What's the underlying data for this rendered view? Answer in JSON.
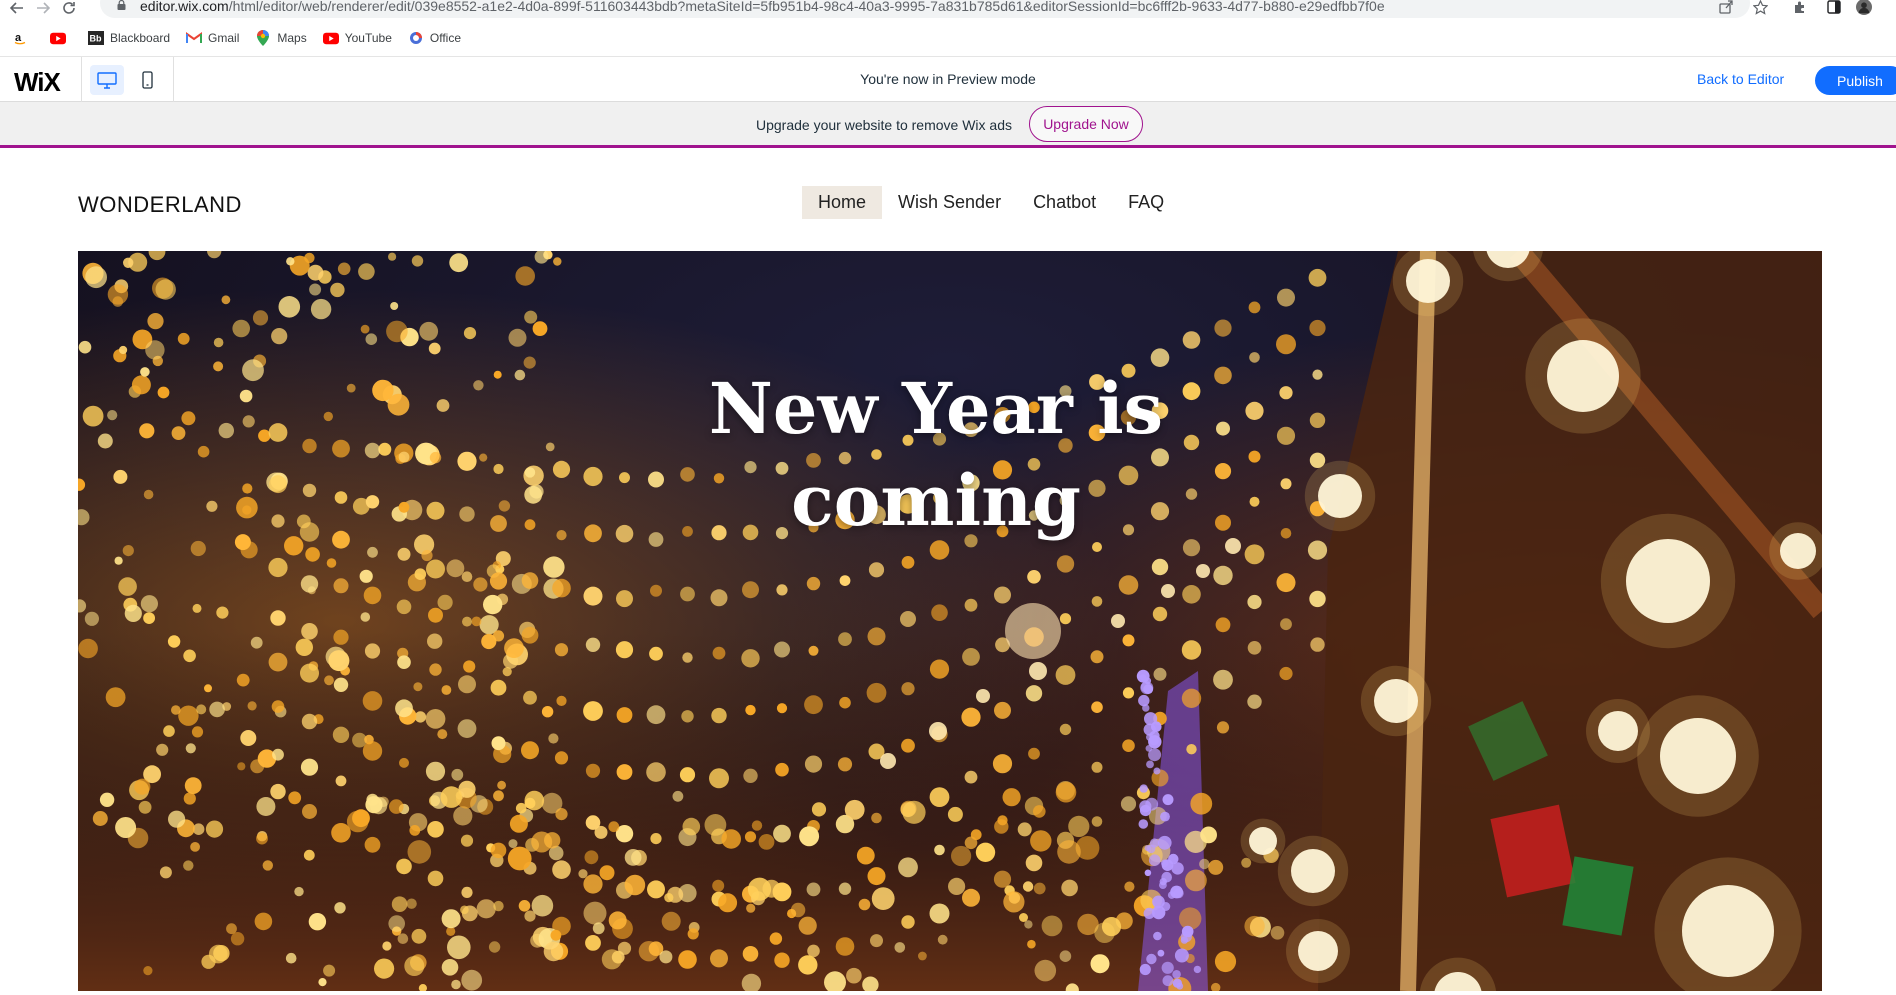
{
  "browser": {
    "url_host": "editor.wix.com",
    "url_path": "/html/editor/web/renderer/edit/039e8552-a1e2-4d0a-899f-511603443bdb?metaSiteId=5fb951b4-98c4-40a3-9995-7a831b785d61&editorSessionId=bc6fff2b-9633-4d77-b880-e29edfbb7f0e",
    "bookmarks": [
      {
        "label": "",
        "icon": "amazon-icon"
      },
      {
        "label": "",
        "icon": "youtube-icon"
      },
      {
        "label": "Blackboard",
        "icon": "blackboard-icon"
      },
      {
        "label": "Gmail",
        "icon": "gmail-icon"
      },
      {
        "label": "Maps",
        "icon": "maps-icon"
      },
      {
        "label": "YouTube",
        "icon": "youtube-icon"
      },
      {
        "label": "Office",
        "icon": "office-icon"
      }
    ]
  },
  "wix_bar": {
    "logo": "WiX",
    "preview_message": "You're now in Preview mode",
    "back_to_editor": "Back to Editor",
    "publish": "Publish"
  },
  "upgrade_banner": {
    "message": "Upgrade your website to remove Wix ads",
    "button": "Upgrade Now"
  },
  "site": {
    "logo": "WONDERLAND",
    "nav": [
      {
        "label": "Home",
        "active": true
      },
      {
        "label": "Wish Sender",
        "active": false
      },
      {
        "label": "Chatbot",
        "active": false
      },
      {
        "label": "FAQ",
        "active": false
      }
    ],
    "hero": {
      "title_line1": "New Year is",
      "title_line2": "coming"
    }
  },
  "colors": {
    "wix_blue": "#116dff",
    "upgrade_purple": "#a0138e",
    "nav_active_bg": "#efe9e1"
  }
}
